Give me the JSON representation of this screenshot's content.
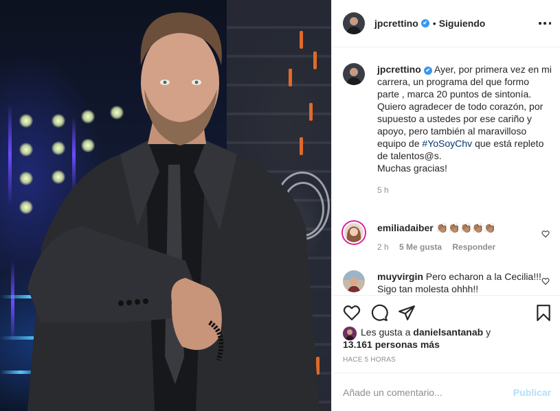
{
  "post": {
    "username": "jpcrettino",
    "verified_mark": "✔",
    "separator": "•",
    "follow_status": "Siguiendo",
    "more_icon": "more-horizontal-icon"
  },
  "caption": {
    "username": "jpcrettino",
    "text_before": "Ayer, por primera vez en mi carrera, un programa del que formo parte , marca 20 puntos de sintonía.\nQuiero agradecer de todo corazón, por supuesto a ustedes por ese cariño y apoyo, pero también al maravilloso equipo de ",
    "hashtag": "#YoSoyChv",
    "text_after": " que está repleto de talentos@s.\nMuchas gracias!",
    "age": "5 h"
  },
  "comments": [
    {
      "username": "emiliadaiber",
      "text": "👏🏽👏🏽👏🏽👏🏽👏🏽",
      "age": "2 h",
      "likes": "5 Me gusta",
      "reply": "Responder"
    },
    {
      "username": "muyvirgin",
      "text": "Pero echaron a la Cecilia!!! Sigo tan molesta ohhh!!"
    }
  ],
  "likes": {
    "prefix": "Les gusta a",
    "user": "danielsantanab",
    "connector": "y",
    "count": "13.161 personas más"
  },
  "timestamp": "Hace 5 horas",
  "composer": {
    "placeholder": "Añade un comentario...",
    "publish": "Publicar"
  },
  "colors": {
    "verified": "#3897f0",
    "hashtag": "#00376b",
    "secondary_text": "#8e8e8e",
    "publish_disabled": "#b2dffc"
  }
}
